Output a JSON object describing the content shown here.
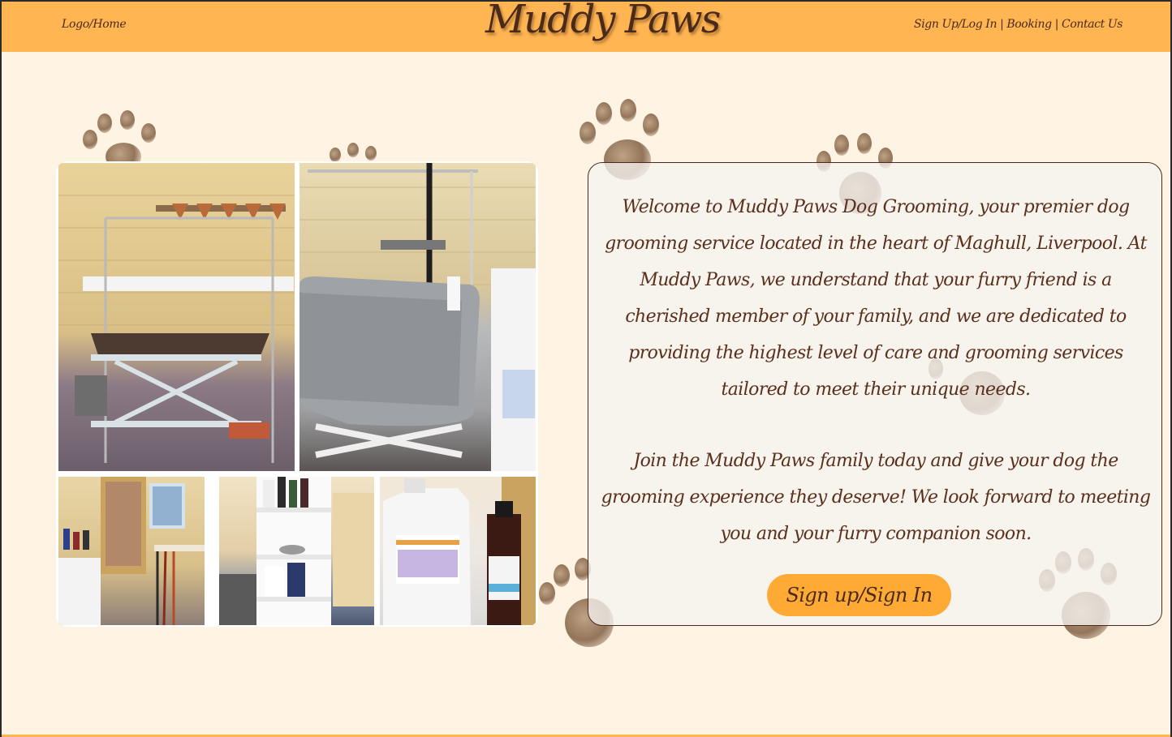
{
  "header": {
    "logo_label": "Logo/Home",
    "site_title": "Muddy Paws",
    "nav": {
      "signup_login": "Sign Up/Log In",
      "separator": "|",
      "booking": "Booking",
      "contact": "Contact Us"
    }
  },
  "gallery": {
    "photos": [
      {
        "alt": "grooming-table-photo"
      },
      {
        "alt": "dog-bath-photo"
      },
      {
        "alt": "leads-hooks-photo"
      },
      {
        "alt": "shelf-supplies-photo"
      },
      {
        "alt": "shampoo-bottles-photo"
      }
    ]
  },
  "intro": {
    "paragraph1": "Welcome to Muddy Paws Dog Grooming, your premier dog grooming service located in the heart of Maghull, Liverpool. At Muddy Paws, we understand that your furry friend is a cherished member of your family, and we are dedicated to providing the highest level of care and grooming services tailored to meet their unique needs.",
    "paragraph2": "Join the Muddy Paws family today and give your dog the grooming experience they deserve! We look forward to meeting you and your furry companion soon.",
    "button_label": "Sign up/Sign In"
  },
  "colors": {
    "header_bg": "#ffb552",
    "page_bg": "#fff4e4",
    "text_brown": "#4a2b1a",
    "button_bg": "#ffaa35"
  }
}
